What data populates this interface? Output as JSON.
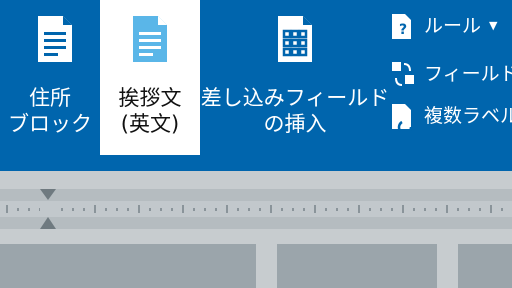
{
  "ribbon": {
    "address_block": {
      "line1": "住所",
      "line2": "ブロック"
    },
    "greeting": {
      "line1": "挨拶文",
      "line2": "(英文)"
    },
    "insert_field": {
      "line1": "差し込みフィールド",
      "line2": "の挿入"
    },
    "rules": {
      "label": "ルール"
    },
    "match_fields": {
      "label": "フィールドの対応"
    },
    "multi_label": {
      "label": "複数ラベルに反映"
    }
  },
  "colors": {
    "ribbon_bg": "#0065ad",
    "selected_bg": "#ffffff",
    "ruler_bg": "#c7cccf"
  }
}
